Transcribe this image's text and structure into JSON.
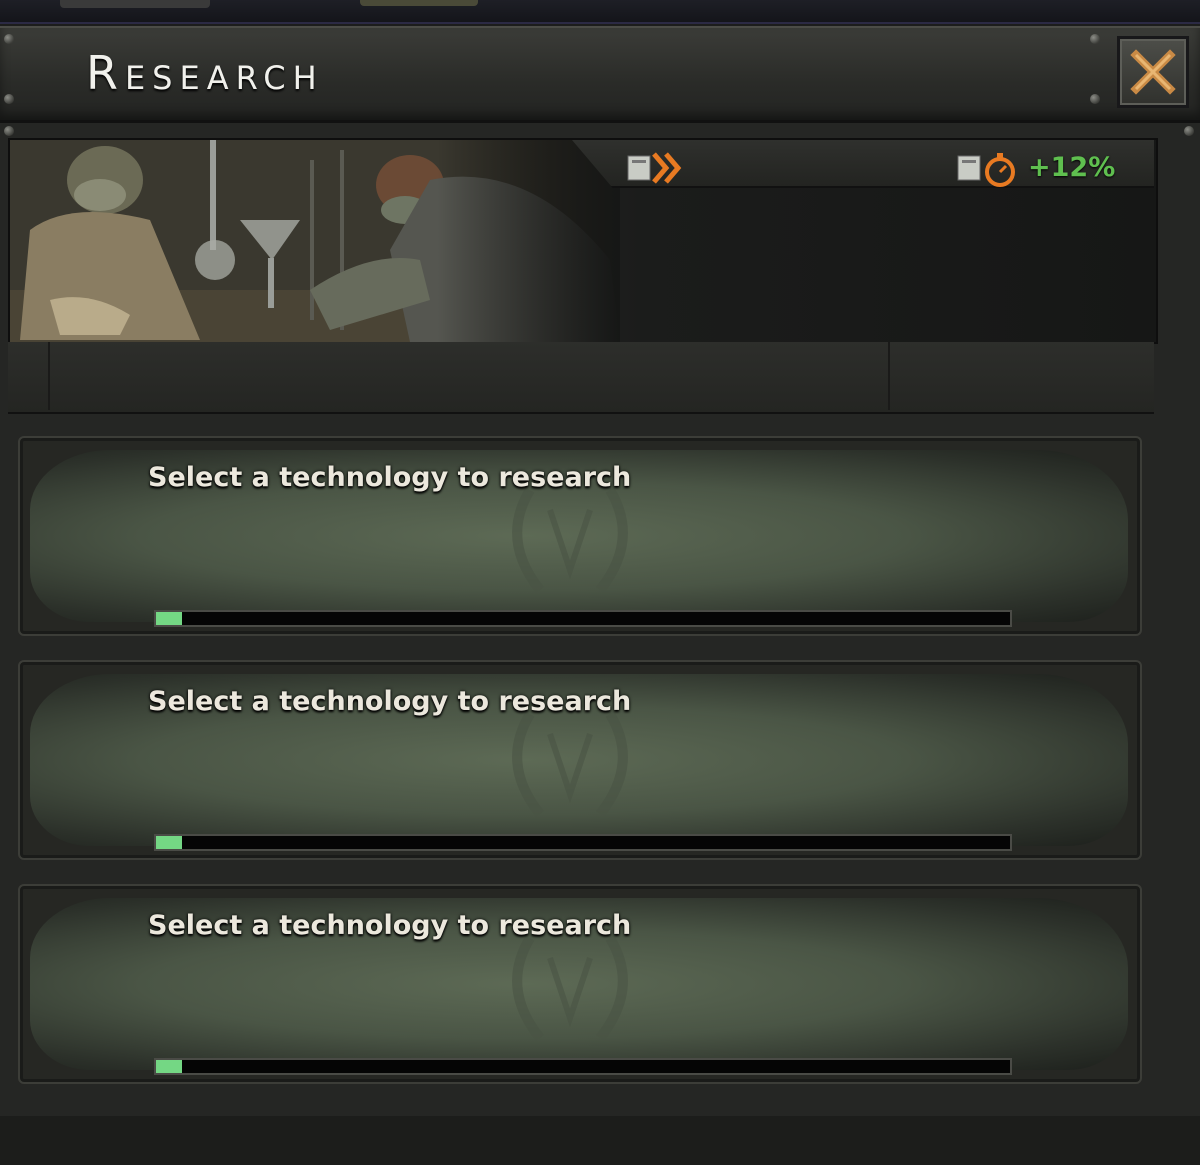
{
  "window": {
    "title": "Research",
    "close_icon": "close-x-icon"
  },
  "banner": {
    "speed_icon": "research-speed-icon",
    "bonus_icon": "research-bonus-timer-icon",
    "bonus_value": "+12%",
    "bonus_color": "#5fbf4f",
    "accent_orange": "#e87a22"
  },
  "slots": [
    {
      "label": "Select a technology to research",
      "progress": 0.03
    },
    {
      "label": "Select a technology to research",
      "progress": 0.03
    },
    {
      "label": "Select a technology to research",
      "progress": 0.03
    }
  ]
}
